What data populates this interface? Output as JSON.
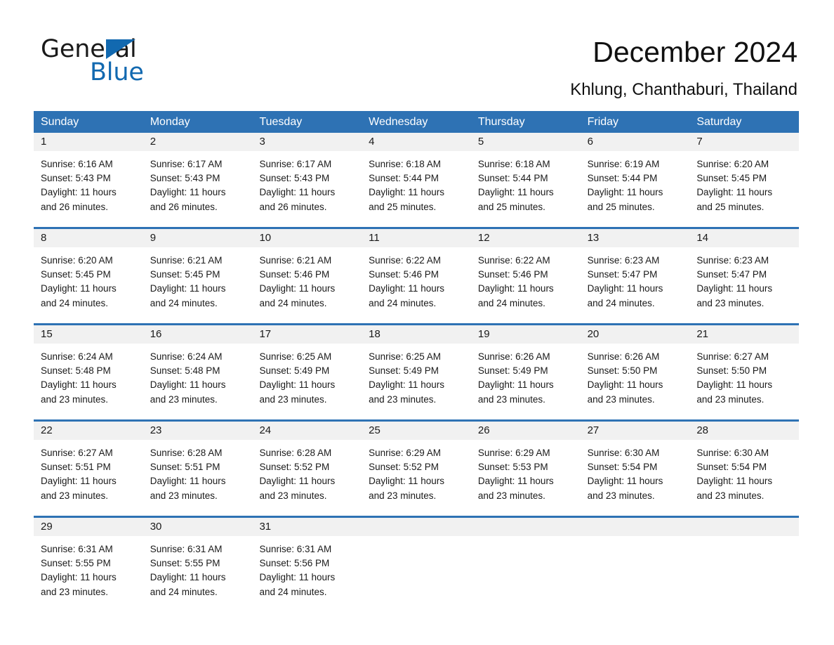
{
  "brand": {
    "name_part1": "General",
    "name_part2": "Blue",
    "accent_color": "#1269b0"
  },
  "header": {
    "title": "December 2024",
    "location": "Khlung, Chanthaburi, Thailand"
  },
  "theme": {
    "header_blue": "#2e72b4",
    "date_band_gray": "#f1f1f1",
    "cell_white": "#ffffff",
    "text_black": "#1a1a1a"
  },
  "weekdays": [
    "Sunday",
    "Monday",
    "Tuesday",
    "Wednesday",
    "Thursday",
    "Friday",
    "Saturday"
  ],
  "weeks": [
    {
      "days": [
        {
          "date": "1",
          "sunrise": "Sunrise: 6:16 AM",
          "sunset": "Sunset: 5:43 PM",
          "daylight_line1": "Daylight: 11 hours",
          "daylight_line2": "and 26 minutes."
        },
        {
          "date": "2",
          "sunrise": "Sunrise: 6:17 AM",
          "sunset": "Sunset: 5:43 PM",
          "daylight_line1": "Daylight: 11 hours",
          "daylight_line2": "and 26 minutes."
        },
        {
          "date": "3",
          "sunrise": "Sunrise: 6:17 AM",
          "sunset": "Sunset: 5:43 PM",
          "daylight_line1": "Daylight: 11 hours",
          "daylight_line2": "and 26 minutes."
        },
        {
          "date": "4",
          "sunrise": "Sunrise: 6:18 AM",
          "sunset": "Sunset: 5:44 PM",
          "daylight_line1": "Daylight: 11 hours",
          "daylight_line2": "and 25 minutes."
        },
        {
          "date": "5",
          "sunrise": "Sunrise: 6:18 AM",
          "sunset": "Sunset: 5:44 PM",
          "daylight_line1": "Daylight: 11 hours",
          "daylight_line2": "and 25 minutes."
        },
        {
          "date": "6",
          "sunrise": "Sunrise: 6:19 AM",
          "sunset": "Sunset: 5:44 PM",
          "daylight_line1": "Daylight: 11 hours",
          "daylight_line2": "and 25 minutes."
        },
        {
          "date": "7",
          "sunrise": "Sunrise: 6:20 AM",
          "sunset": "Sunset: 5:45 PM",
          "daylight_line1": "Daylight: 11 hours",
          "daylight_line2": "and 25 minutes."
        }
      ]
    },
    {
      "days": [
        {
          "date": "8",
          "sunrise": "Sunrise: 6:20 AM",
          "sunset": "Sunset: 5:45 PM",
          "daylight_line1": "Daylight: 11 hours",
          "daylight_line2": "and 24 minutes."
        },
        {
          "date": "9",
          "sunrise": "Sunrise: 6:21 AM",
          "sunset": "Sunset: 5:45 PM",
          "daylight_line1": "Daylight: 11 hours",
          "daylight_line2": "and 24 minutes."
        },
        {
          "date": "10",
          "sunrise": "Sunrise: 6:21 AM",
          "sunset": "Sunset: 5:46 PM",
          "daylight_line1": "Daylight: 11 hours",
          "daylight_line2": "and 24 minutes."
        },
        {
          "date": "11",
          "sunrise": "Sunrise: 6:22 AM",
          "sunset": "Sunset: 5:46 PM",
          "daylight_line1": "Daylight: 11 hours",
          "daylight_line2": "and 24 minutes."
        },
        {
          "date": "12",
          "sunrise": "Sunrise: 6:22 AM",
          "sunset": "Sunset: 5:46 PM",
          "daylight_line1": "Daylight: 11 hours",
          "daylight_line2": "and 24 minutes."
        },
        {
          "date": "13",
          "sunrise": "Sunrise: 6:23 AM",
          "sunset": "Sunset: 5:47 PM",
          "daylight_line1": "Daylight: 11 hours",
          "daylight_line2": "and 24 minutes."
        },
        {
          "date": "14",
          "sunrise": "Sunrise: 6:23 AM",
          "sunset": "Sunset: 5:47 PM",
          "daylight_line1": "Daylight: 11 hours",
          "daylight_line2": "and 23 minutes."
        }
      ]
    },
    {
      "days": [
        {
          "date": "15",
          "sunrise": "Sunrise: 6:24 AM",
          "sunset": "Sunset: 5:48 PM",
          "daylight_line1": "Daylight: 11 hours",
          "daylight_line2": "and 23 minutes."
        },
        {
          "date": "16",
          "sunrise": "Sunrise: 6:24 AM",
          "sunset": "Sunset: 5:48 PM",
          "daylight_line1": "Daylight: 11 hours",
          "daylight_line2": "and 23 minutes."
        },
        {
          "date": "17",
          "sunrise": "Sunrise: 6:25 AM",
          "sunset": "Sunset: 5:49 PM",
          "daylight_line1": "Daylight: 11 hours",
          "daylight_line2": "and 23 minutes."
        },
        {
          "date": "18",
          "sunrise": "Sunrise: 6:25 AM",
          "sunset": "Sunset: 5:49 PM",
          "daylight_line1": "Daylight: 11 hours",
          "daylight_line2": "and 23 minutes."
        },
        {
          "date": "19",
          "sunrise": "Sunrise: 6:26 AM",
          "sunset": "Sunset: 5:49 PM",
          "daylight_line1": "Daylight: 11 hours",
          "daylight_line2": "and 23 minutes."
        },
        {
          "date": "20",
          "sunrise": "Sunrise: 6:26 AM",
          "sunset": "Sunset: 5:50 PM",
          "daylight_line1": "Daylight: 11 hours",
          "daylight_line2": "and 23 minutes."
        },
        {
          "date": "21",
          "sunrise": "Sunrise: 6:27 AM",
          "sunset": "Sunset: 5:50 PM",
          "daylight_line1": "Daylight: 11 hours",
          "daylight_line2": "and 23 minutes."
        }
      ]
    },
    {
      "days": [
        {
          "date": "22",
          "sunrise": "Sunrise: 6:27 AM",
          "sunset": "Sunset: 5:51 PM",
          "daylight_line1": "Daylight: 11 hours",
          "daylight_line2": "and 23 minutes."
        },
        {
          "date": "23",
          "sunrise": "Sunrise: 6:28 AM",
          "sunset": "Sunset: 5:51 PM",
          "daylight_line1": "Daylight: 11 hours",
          "daylight_line2": "and 23 minutes."
        },
        {
          "date": "24",
          "sunrise": "Sunrise: 6:28 AM",
          "sunset": "Sunset: 5:52 PM",
          "daylight_line1": "Daylight: 11 hours",
          "daylight_line2": "and 23 minutes."
        },
        {
          "date": "25",
          "sunrise": "Sunrise: 6:29 AM",
          "sunset": "Sunset: 5:52 PM",
          "daylight_line1": "Daylight: 11 hours",
          "daylight_line2": "and 23 minutes."
        },
        {
          "date": "26",
          "sunrise": "Sunrise: 6:29 AM",
          "sunset": "Sunset: 5:53 PM",
          "daylight_line1": "Daylight: 11 hours",
          "daylight_line2": "and 23 minutes."
        },
        {
          "date": "27",
          "sunrise": "Sunrise: 6:30 AM",
          "sunset": "Sunset: 5:54 PM",
          "daylight_line1": "Daylight: 11 hours",
          "daylight_line2": "and 23 minutes."
        },
        {
          "date": "28",
          "sunrise": "Sunrise: 6:30 AM",
          "sunset": "Sunset: 5:54 PM",
          "daylight_line1": "Daylight: 11 hours",
          "daylight_line2": "and 23 minutes."
        }
      ]
    },
    {
      "days": [
        {
          "date": "29",
          "sunrise": "Sunrise: 6:31 AM",
          "sunset": "Sunset: 5:55 PM",
          "daylight_line1": "Daylight: 11 hours",
          "daylight_line2": "and 23 minutes."
        },
        {
          "date": "30",
          "sunrise": "Sunrise: 6:31 AM",
          "sunset": "Sunset: 5:55 PM",
          "daylight_line1": "Daylight: 11 hours",
          "daylight_line2": "and 24 minutes."
        },
        {
          "date": "31",
          "sunrise": "Sunrise: 6:31 AM",
          "sunset": "Sunset: 5:56 PM",
          "daylight_line1": "Daylight: 11 hours",
          "daylight_line2": "and 24 minutes."
        },
        {
          "date": "",
          "sunrise": "",
          "sunset": "",
          "daylight_line1": "",
          "daylight_line2": ""
        },
        {
          "date": "",
          "sunrise": "",
          "sunset": "",
          "daylight_line1": "",
          "daylight_line2": ""
        },
        {
          "date": "",
          "sunrise": "",
          "sunset": "",
          "daylight_line1": "",
          "daylight_line2": ""
        },
        {
          "date": "",
          "sunrise": "",
          "sunset": "",
          "daylight_line1": "",
          "daylight_line2": ""
        }
      ]
    }
  ]
}
